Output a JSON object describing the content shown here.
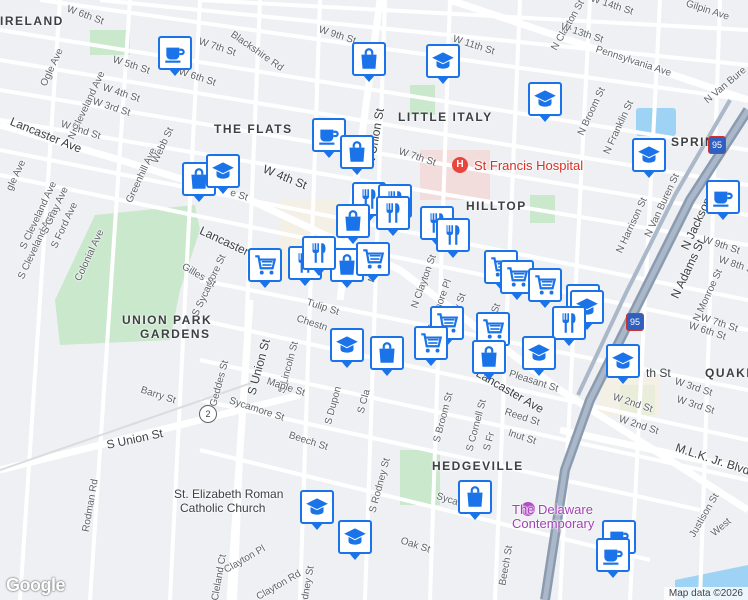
{
  "map": {
    "attribution": "Map data ©2026",
    "logo": "Google",
    "neighborhoods": [
      {
        "id": "ireland",
        "text": "IRELAND"
      },
      {
        "id": "the-flats",
        "text": "THE FLATS"
      },
      {
        "id": "little-italy",
        "text": "LITTLE ITALY"
      },
      {
        "id": "hilltop",
        "text": "HILLTOP"
      },
      {
        "id": "union-park-gardens",
        "text": "UNION PARK"
      },
      {
        "id": "union-park-gardens-2",
        "text": "GARDENS"
      },
      {
        "id": "hedgeville",
        "text": "HEDGEVILLE"
      },
      {
        "id": "spring",
        "text": "SPRING"
      },
      {
        "id": "quaker",
        "text": "QUAKE"
      }
    ],
    "places": [
      {
        "id": "st-francis-hospital",
        "text": "St Francis Hospital",
        "color": "#d93025"
      },
      {
        "id": "st-elizabeth-1",
        "text": "St. Elizabeth Roman",
        "color": "#3c4043"
      },
      {
        "id": "st-elizabeth-2",
        "text": "Catholic Church",
        "color": "#3c4043"
      },
      {
        "id": "delaware-contemporary-1",
        "text": "The Delaware",
        "color": "#a142b5"
      },
      {
        "id": "delaware-contemporary-2",
        "text": "Contemporary",
        "color": "#a142b5"
      }
    ],
    "streets": [
      {
        "id": "w6th",
        "text": "W 6th St"
      },
      {
        "id": "w7th-a",
        "text": "W 7th St"
      },
      {
        "id": "blackshire",
        "text": "Blackshire Rd"
      },
      {
        "id": "w9th",
        "text": "W 9th St"
      },
      {
        "id": "w11th",
        "text": "W 11th St"
      },
      {
        "id": "nclayton-top",
        "text": "N Clayton St"
      },
      {
        "id": "w14th",
        "text": "W 14th St"
      },
      {
        "id": "w13th",
        "text": "W 13th St"
      },
      {
        "id": "gilpin",
        "text": "Gilpin Ave"
      },
      {
        "id": "pennsylvania",
        "text": "Pennsylvania Ave"
      },
      {
        "id": "nvanburen-top",
        "text": "N Van Bure"
      },
      {
        "id": "ogle",
        "text": "Ogle Ave"
      },
      {
        "id": "ncleveland",
        "text": "N Cleveland Ave"
      },
      {
        "id": "w5th",
        "text": "W 5th St"
      },
      {
        "id": "w6th-b",
        "text": "W 6th St"
      },
      {
        "id": "w4th-a",
        "text": "W 4th St"
      },
      {
        "id": "w3rd",
        "text": "W 3rd St"
      },
      {
        "id": "w2nd",
        "text": "W 2nd St"
      },
      {
        "id": "greenhill",
        "text": "Greenhill Ave"
      },
      {
        "id": "webb",
        "text": "Webb St"
      },
      {
        "id": "lancaster-w",
        "text": "Lancaster Ave"
      },
      {
        "id": "w4th-main",
        "text": "W 4th St"
      },
      {
        "id": "union-n",
        "text": "N Union St"
      },
      {
        "id": "w7th-b",
        "text": "W 7th St"
      },
      {
        "id": "nbroom",
        "text": "N Broom St"
      },
      {
        "id": "nfranklin",
        "text": "N Franklin St"
      },
      {
        "id": "nharrison",
        "text": "N Harrison St"
      },
      {
        "id": "nvanburen",
        "text": "N Van Buren St"
      },
      {
        "id": "njackson",
        "text": "N Jackson St"
      },
      {
        "id": "nadams",
        "text": "N Adams St"
      },
      {
        "id": "w9th-e",
        "text": "W 9th St"
      },
      {
        "id": "w8th-e",
        "text": "W 8th St"
      },
      {
        "id": "nmonroe",
        "text": "N Monroe St"
      },
      {
        "id": "w7th-e",
        "text": "W 7th St"
      },
      {
        "id": "w6th-e",
        "text": "W 6th St"
      },
      {
        "id": "w3rd-e",
        "text": "W 3rd St"
      },
      {
        "id": "w2nd-e",
        "text": "W 2nd St"
      },
      {
        "id": "th-st",
        "text": "th St"
      },
      {
        "id": "sycamore-w",
        "text": "S Sycamore St"
      },
      {
        "id": "gilles",
        "text": "Gilles St"
      },
      {
        "id": "cleveland-s",
        "text": "S Cleveland Ave"
      },
      {
        "id": "gray",
        "text": "S Gray Ave"
      },
      {
        "id": "ford",
        "text": "S Ford Ave"
      },
      {
        "id": "colonial",
        "text": "Colonial Ave"
      },
      {
        "id": "lancaster-mid",
        "text": "Lancaster"
      },
      {
        "id": "sunion",
        "text": "S Union St"
      },
      {
        "id": "slincoln",
        "text": "S Lincoln St"
      },
      {
        "id": "tulip",
        "text": "Tulip St"
      },
      {
        "id": "chestnut",
        "text": "Chestn"
      },
      {
        "id": "sdupont",
        "text": "S Dupon"
      },
      {
        "id": "sclay",
        "text": "S Cla"
      },
      {
        "id": "maple",
        "text": "Maple St"
      },
      {
        "id": "sycamore-s",
        "text": "Sycamore St"
      },
      {
        "id": "geddes",
        "text": "Geddes St"
      },
      {
        "id": "barry",
        "text": "Barry St"
      },
      {
        "id": "sunion-w",
        "text": "S Union St"
      },
      {
        "id": "beech",
        "text": "Beech St"
      },
      {
        "id": "srodney",
        "text": "S Rodney St"
      },
      {
        "id": "sbroom",
        "text": "S Broom St"
      },
      {
        "id": "scornell",
        "text": "S Cornell St"
      },
      {
        "id": "sfr",
        "text": "S Fr"
      },
      {
        "id": "reed",
        "text": "Reed St"
      },
      {
        "id": "walnut",
        "text": "lnut St"
      },
      {
        "id": "pleasant",
        "text": "Pleasant St"
      },
      {
        "id": "lancaster-e",
        "text": "Lancaster Ave"
      },
      {
        "id": "delamore",
        "text": "Delamore Pl"
      },
      {
        "id": "nclayton",
        "text": "N Clayton St"
      },
      {
        "id": "rodney-n",
        "text": "Rodney St"
      },
      {
        "id": "ndu",
        "text": "N Du"
      },
      {
        "id": "broom-mid",
        "text": "Broom St"
      },
      {
        "id": "mlk",
        "text": "M.L.K. Jr. Blvd"
      },
      {
        "id": "w3rd-se",
        "text": "W 3rd St"
      },
      {
        "id": "w2nd-se",
        "text": "W 2nd St"
      },
      {
        "id": "rodman",
        "text": "Rodman Rd"
      },
      {
        "id": "clayton-pl",
        "text": "Clayton Pl"
      },
      {
        "id": "cleland",
        "text": "Cleland Ct"
      },
      {
        "id": "clayton-rd",
        "text": "Clayton Rd"
      },
      {
        "id": "rodney-s",
        "text": "odney St"
      },
      {
        "id": "oak",
        "text": "Oak St"
      },
      {
        "id": "beech-s",
        "text": "Beech St"
      },
      {
        "id": "syca",
        "text": "Syca"
      },
      {
        "id": "justison",
        "text": "Justison St"
      },
      {
        "id": "west",
        "text": "West"
      },
      {
        "id": "sw-cleveland",
        "text": "S Cleveland Ave"
      },
      {
        "id": "gle-ave",
        "text": "gle Ave"
      },
      {
        "id": "e-st",
        "text": "e St"
      }
    ],
    "route_shields": [
      {
        "id": "route-2",
        "text": "2"
      },
      {
        "id": "i95-a",
        "text": "95"
      },
      {
        "id": "i95-b",
        "text": "95"
      }
    ],
    "markers": [
      {
        "id": "coffee-1",
        "icon": "coffee-icon"
      },
      {
        "id": "shopping-1",
        "icon": "shopping-bag-icon"
      },
      {
        "id": "school-1",
        "icon": "school-icon"
      },
      {
        "id": "school-2",
        "icon": "school-icon"
      },
      {
        "id": "coffee-2",
        "icon": "coffee-icon"
      },
      {
        "id": "shopping-2",
        "icon": "shopping-bag-icon"
      },
      {
        "id": "school-3",
        "icon": "school-icon"
      },
      {
        "id": "shopping-3",
        "icon": "shopping-bag-icon"
      },
      {
        "id": "school-4",
        "icon": "school-icon"
      },
      {
        "id": "coffee-3",
        "icon": "coffee-icon"
      },
      {
        "id": "restaurant-1",
        "icon": "restaurant-icon"
      },
      {
        "id": "restaurant-2",
        "icon": "restaurant-icon"
      },
      {
        "id": "shopping-4",
        "icon": "shopping-bag-icon"
      },
      {
        "id": "restaurant-3",
        "icon": "restaurant-icon"
      },
      {
        "id": "restaurant-4",
        "icon": "restaurant-icon"
      },
      {
        "id": "restaurant-5",
        "icon": "restaurant-icon"
      },
      {
        "id": "grocery-1",
        "icon": "cart-icon"
      },
      {
        "id": "restaurant-6",
        "icon": "restaurant-icon"
      },
      {
        "id": "shopping-5",
        "icon": "shopping-bag-icon"
      },
      {
        "id": "grocery-2",
        "icon": "cart-icon"
      },
      {
        "id": "grocery-3",
        "icon": "cart-icon"
      },
      {
        "id": "grocery-4",
        "icon": "cart-icon"
      },
      {
        "id": "grocery-5",
        "icon": "cart-icon"
      },
      {
        "id": "shopping-6",
        "icon": "shopping-bag-icon"
      },
      {
        "id": "school-5",
        "icon": "school-icon"
      },
      {
        "id": "restaurant-7",
        "icon": "restaurant-icon"
      },
      {
        "id": "grocery-6",
        "icon": "cart-icon"
      },
      {
        "id": "grocery-7",
        "icon": "cart-icon"
      },
      {
        "id": "grocery-8",
        "icon": "cart-icon"
      },
      {
        "id": "shopping-7",
        "icon": "shopping-bag-icon"
      },
      {
        "id": "school-6",
        "icon": "school-icon"
      },
      {
        "id": "school-7",
        "icon": "school-icon"
      },
      {
        "id": "shopping-8",
        "icon": "shopping-bag-icon"
      },
      {
        "id": "school-8",
        "icon": "school-icon"
      },
      {
        "id": "shopping-9",
        "icon": "shopping-bag-icon"
      },
      {
        "id": "school-9",
        "icon": "school-icon"
      },
      {
        "id": "school-10",
        "icon": "school-icon"
      },
      {
        "id": "coffee-4",
        "icon": "coffee-icon"
      },
      {
        "id": "coffee-5",
        "icon": "coffee-icon"
      },
      {
        "id": "restaurant-8",
        "icon": "restaurant-icon"
      }
    ],
    "colors": {
      "pin_border": "#1a73e8",
      "pin_icon": "#1a73e8",
      "highway": "#8a9bb0",
      "park": "#c9e8cc",
      "water": "#9fd3f5",
      "road": "#ffffff"
    }
  }
}
